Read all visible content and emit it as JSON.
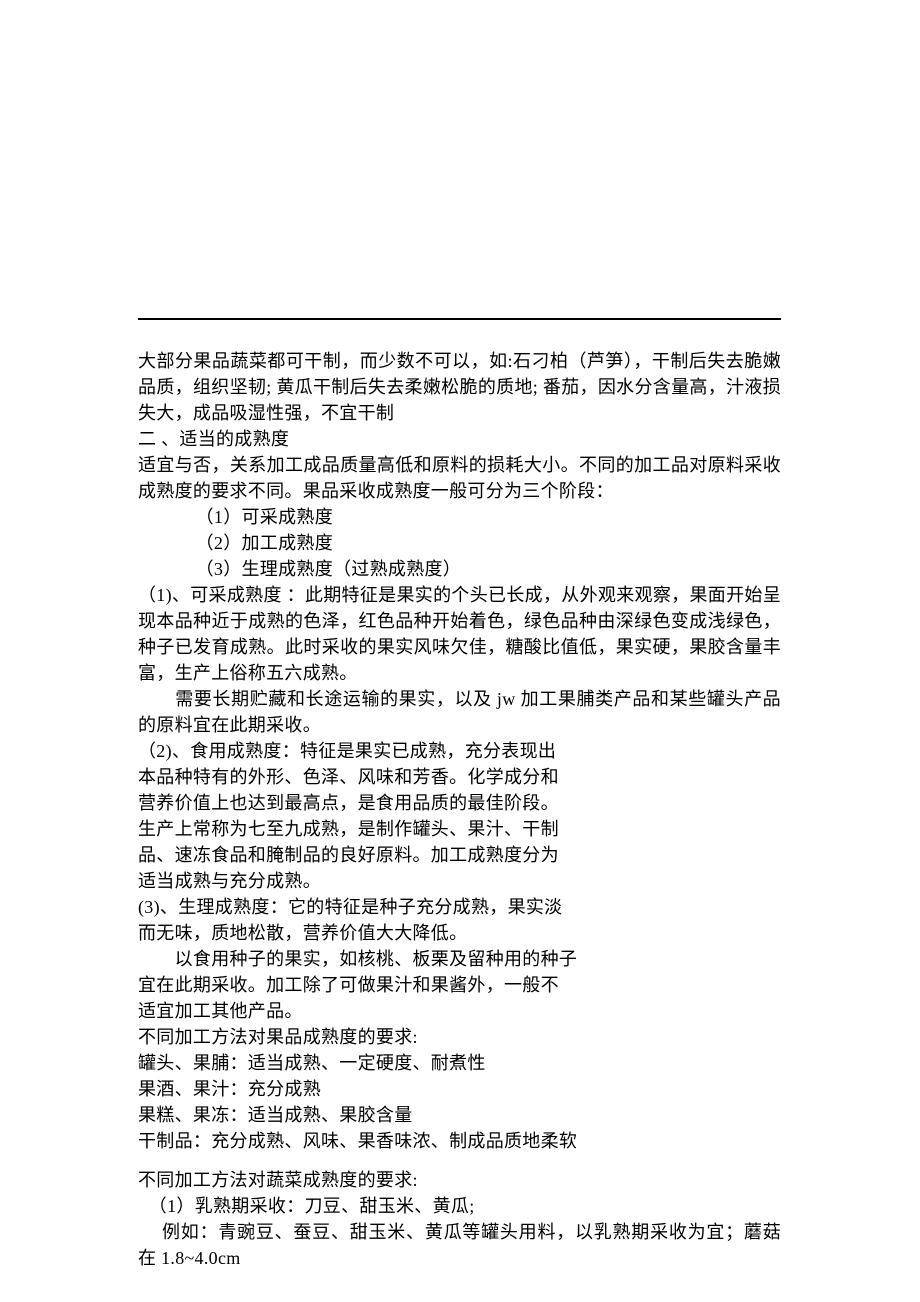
{
  "p": [
    "大部分果品蔬菜都可干制，而少数不可以，如:石刁柏（芦笋），干制后失去脆嫩品质，组织坚韧; 黄瓜干制后失去柔嫩松脆的质地; 番茄，因水分含量高，汁液损失大，成品吸湿性强，不宜干制",
    "二 、适当的成熟度",
    "适宜与否，关系加工成品质量高低和原料的损耗大小。不同的加工品对原料采收成熟度的要求不同。果品采收成熟度一般可分为三个阶段：",
    "（1）可采成熟度",
    "（2）加工成熟度",
    "（3）生理成熟度（过熟成熟度）",
    "（1)、可采成熟度 ：此期特征是果实的个头已长成，从外观来观察，果面开始呈现本品种近于成熟的色泽，红色品种开始着色，绿色品种由深绿色变成浅绿色，种子已发育成熟。此时采收的果实风味欠佳，糖酸比值低，果实硬，果胶含量丰富，生产上俗称五六成熟。",
    "　　需要长期贮藏和长途运输的果实，以及 jw 加工果脯类产品和某些罐头产品的原料宜在此期采收。",
    "（2)、食用成熟度：特征是果实已成熟，充分表现出",
    "本品种特有的外形、色泽、风味和芳香。化学成分和",
    "营养价值上也达到最高点，是食用品质的最佳阶段。",
    "生产上常称为七至九成熟，是制作罐头、果汁、干制",
    "品、速冻食品和腌制品的良好原料。加工成熟度分为",
    "适当成熟与充分成熟。",
    "(3)、生理成熟度：它的特征是种子充分成熟，果实淡",
    "而无味，质地松散，营养价值大大降低。",
    "　　以食用种子的果实，如核桃、板栗及留种用的种子",
    "宜在此期采收。加工除了可做果汁和果酱外，一般不",
    "适宜加工其他产品。",
    "不同加工方法对果品成熟度的要求:",
    "罐头、果脯：适当成熟、一定硬度、耐煮性",
    "果酒、果汁：充分成熟",
    "果糕、果冻：适当成熟、果胶含量",
    "干制品：充分成熟、风味、果香味浓、制成品质地柔软",
    "不同加工方法对蔬菜成熟度的要求:",
    "（1）乳熟期采收：刀豆、甜玉米、黄瓜;",
    "　 例如：青豌豆、蚕豆、甜玉米、黄瓜等罐头用料，以乳熟期采收为宜；蘑菇在 1.8~4.0cm"
  ]
}
